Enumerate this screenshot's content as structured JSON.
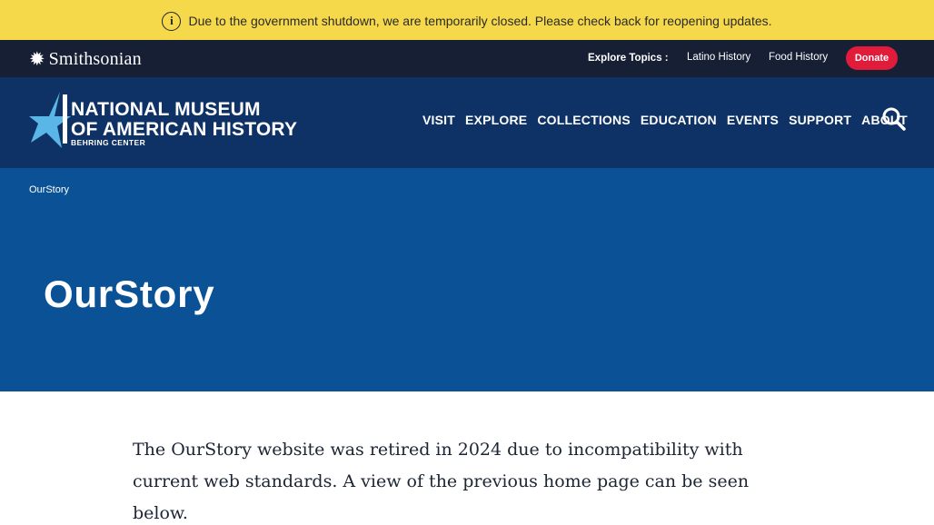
{
  "alert": {
    "icon": "info-circle-icon",
    "text": "Due to the government shutdown, we are temporarily closed. Please check back for reopening updates."
  },
  "top_bar": {
    "logo_text": "Smithsonian",
    "logo_icon": "sun-icon",
    "explore_label": "Explore Topics :",
    "topics": [
      "Latino History",
      "Food History"
    ],
    "donate_label": "Donate",
    "colors": {
      "background": "#171f35",
      "donate": "#e11b3a"
    }
  },
  "header": {
    "logo_lines": [
      "NATIONAL MUSEUM",
      "OF AMERICAN HISTORY",
      "BEHRING CENTER"
    ],
    "nav": [
      "VISIT",
      "EXPLORE",
      "COLLECTIONS",
      "EDUCATION",
      "EVENTS",
      "SUPPORT",
      "ABOUT"
    ],
    "search_icon": "search-icon",
    "colors": {
      "background": "#0e3265",
      "star": "#5ab6e6"
    }
  },
  "hero": {
    "breadcrumb": "OurStory",
    "title": "OurStory",
    "colors": {
      "background": "#0a5295"
    }
  },
  "content": {
    "paragraph": "The OurStory website was retired in 2024 due to incompatibility with current web standards. A view of the previous home page can be seen below."
  },
  "colors": {
    "alert_background": "#f6d94a"
  }
}
